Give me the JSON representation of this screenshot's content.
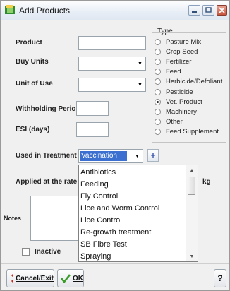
{
  "window": {
    "title": "Add Products"
  },
  "form": {
    "product_label": "Product",
    "buy_units_label": "Buy Units",
    "unit_of_use_label": "Unit of Use",
    "withholding_label": "Withholding Period",
    "esi_label": "ESI (days)",
    "treatment_label": "Used in Treatment",
    "treatment_value": "Vaccination",
    "applied_label": "Applied at the rate o",
    "applied_unit": "kg",
    "notes_label": "Notes",
    "inactive_label": "Inactive"
  },
  "type_group": {
    "label": "Type",
    "options": [
      {
        "label": "Pasture Mix",
        "selected": false
      },
      {
        "label": "Crop Seed",
        "selected": false
      },
      {
        "label": "Fertilizer",
        "selected": false
      },
      {
        "label": "Feed",
        "selected": false
      },
      {
        "label": "Herbicide/Defoliant",
        "selected": false
      },
      {
        "label": "Pesticide",
        "selected": false
      },
      {
        "label": "Vet. Product",
        "selected": true
      },
      {
        "label": "Machinery",
        "selected": false
      },
      {
        "label": "Other",
        "selected": false
      },
      {
        "label": "Feed Supplement",
        "selected": false
      }
    ]
  },
  "dropdown": {
    "items": [
      "Antibiotics",
      "Feeding",
      "Fly Control",
      "Lice and Worm Control",
      "Lice Control",
      "Re-growth treatment",
      "SB Fibre Test",
      "Spraying"
    ]
  },
  "buttons": {
    "cancel": "Cancel/Exit",
    "ok": "OK",
    "help": "?"
  },
  "colors": {
    "selection": "#3b6fd0",
    "cancel_x": "#cc2a1e",
    "ok_check": "#3d9b2a"
  }
}
